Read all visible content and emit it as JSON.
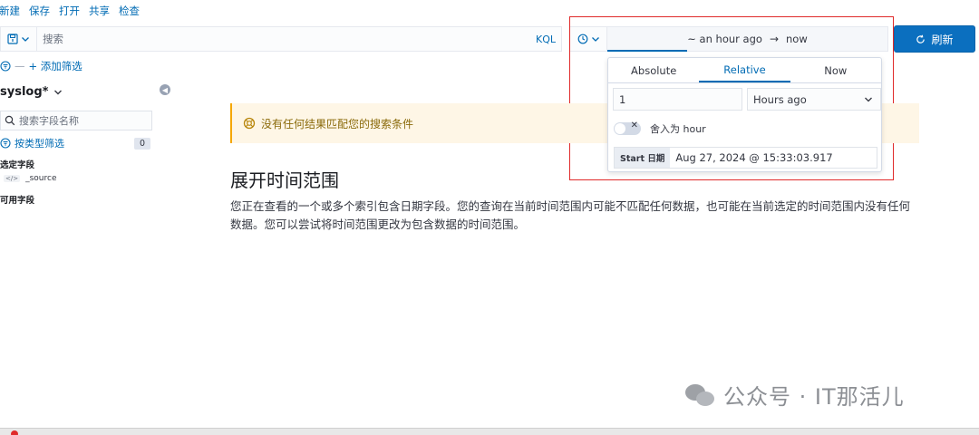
{
  "top_menu": {
    "new": "新建",
    "save": "保存",
    "open": "打开",
    "share": "共享",
    "inspect": "检查"
  },
  "query_bar": {
    "placeholder": "搜索",
    "language": "KQL"
  },
  "date_picker": {
    "start": "~ an hour ago",
    "arrow": "→",
    "end": "now"
  },
  "refresh_button": {
    "label": "刷新"
  },
  "filter_bar": {
    "dash": "—",
    "add_filter": "+ 添加筛选"
  },
  "sidebar": {
    "index_pattern": "syslog*",
    "field_search_placeholder": "搜索字段名称",
    "filter_by_type": "按类型筛选",
    "filter_count": "0",
    "selected_fields_title": "选定字段",
    "source_field": "_source",
    "available_fields_title": "可用字段"
  },
  "callout": {
    "text": "没有任何结果匹配您的搜索条件"
  },
  "main": {
    "title": "展开时间范围",
    "description": "您正在查看的一个或多个索引包含日期字段。您的查询在当前时间范围内可能不匹配任何数据，也可能在当前选定的时间范围内没有任何数据。您可以尝试将时间范围更改为包含数据的时间范围。"
  },
  "popover": {
    "tabs": [
      "Absolute",
      "Relative",
      "Now"
    ],
    "active_tab": "Relative",
    "amount": "1",
    "unit": "Hours ago",
    "round_label": "舍入为 hour",
    "start_label": "Start 日期",
    "start_value": "Aug 27, 2024 @ 15:33:03.917"
  },
  "watermark": {
    "text": "公众号 · IT那活儿"
  },
  "colors": {
    "accent": "#006bb4",
    "refresh_bg": "#0b6fbf",
    "callout_bg": "#fef6e6",
    "annotation": "#e02a2a"
  }
}
